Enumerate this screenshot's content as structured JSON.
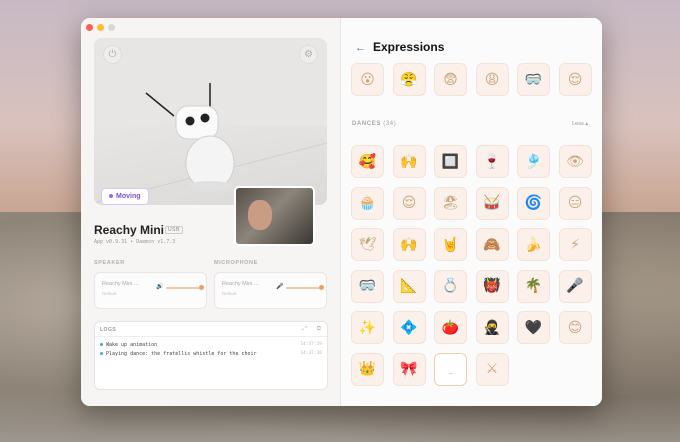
{
  "robot": {
    "name": "Reachy Mini",
    "connection": "USB",
    "version_line": "App v0.9.31 • Daemon v1.7.3",
    "status": "Moving"
  },
  "audio": {
    "speaker_label": "SPEAKER",
    "microphone_label": "MICROPHONE",
    "speaker_device": "Reachy Mini ...",
    "speaker_sub": "Default",
    "mic_device": "Reachy Mini ...",
    "mic_sub": "Default"
  },
  "logs": {
    "title": "LOGS",
    "entries": [
      {
        "text": "Wake up animation",
        "time": "14:37:19",
        "color": "#3db36a"
      },
      {
        "text": "Playing dance: the fratellis whistle for the choir",
        "time": "14:37:26",
        "color": "#4aa7d8"
      }
    ]
  },
  "panel": {
    "title": "Expressions",
    "dances_label": "DANCES",
    "dances_count": "(34)",
    "toggle_label": "Less ▴"
  },
  "expressions_row": [
    "😮",
    "😤",
    "😨",
    "😩",
    "🥽",
    "😌"
  ],
  "dances": [
    "🥰",
    "🙌",
    "🔲",
    "🍷",
    "🎐",
    "👁",
    "🧁",
    "😌",
    "🏖",
    "🥁",
    "🌀",
    "😑",
    "🕊",
    "🙌",
    "🤘",
    "🙈",
    "🍌",
    "⚡",
    "🥽",
    "📐",
    "💍",
    "👹",
    "🌴",
    "🎤",
    "✨",
    "💠",
    "🍅",
    "🥷",
    "🖤",
    "😊",
    "👑",
    "🎀",
    "_",
    "⚔"
  ]
}
